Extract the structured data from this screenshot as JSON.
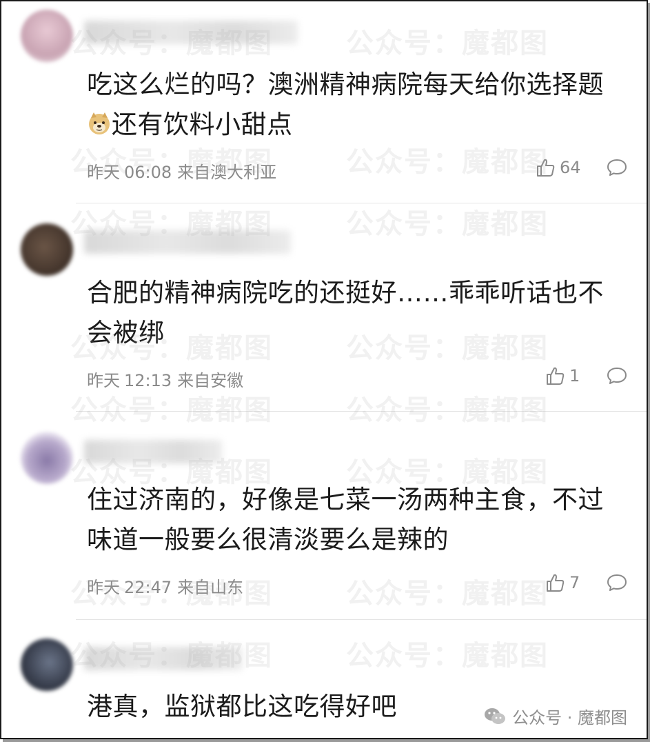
{
  "watermark": {
    "text_a": "公众号：",
    "text_b": "魔都图"
  },
  "comments": [
    {
      "avatar_color": "#c9a4b3",
      "text": "吃这么烂的吗？澳洲精神病院每天给你选择题",
      "text_tail": "还有饮料小甜点",
      "date": "昨天",
      "time": "06:08",
      "location": "来自澳大利亚",
      "likes": "64"
    },
    {
      "avatar_color": "#4a3a30",
      "text": "合肥的精神病院吃的还挺好……乖乖听话也不会被绑",
      "date": "昨天",
      "time": "12:13",
      "location": "来自安徽",
      "likes": "1"
    },
    {
      "avatar_color": "#8a7aa8",
      "text": "住过济南的，好像是七菜一汤两种主食，不过味道一般要么很清淡要么是辣的",
      "date": "昨天",
      "time": "22:47",
      "location": "来自山东",
      "likes": "7"
    },
    {
      "avatar_color": "#3b4150",
      "text": "港真，监狱都比这吃得好吧"
    }
  ],
  "footer": {
    "label": "公众号 · 魔都图",
    "icon": "wechat-icon"
  }
}
